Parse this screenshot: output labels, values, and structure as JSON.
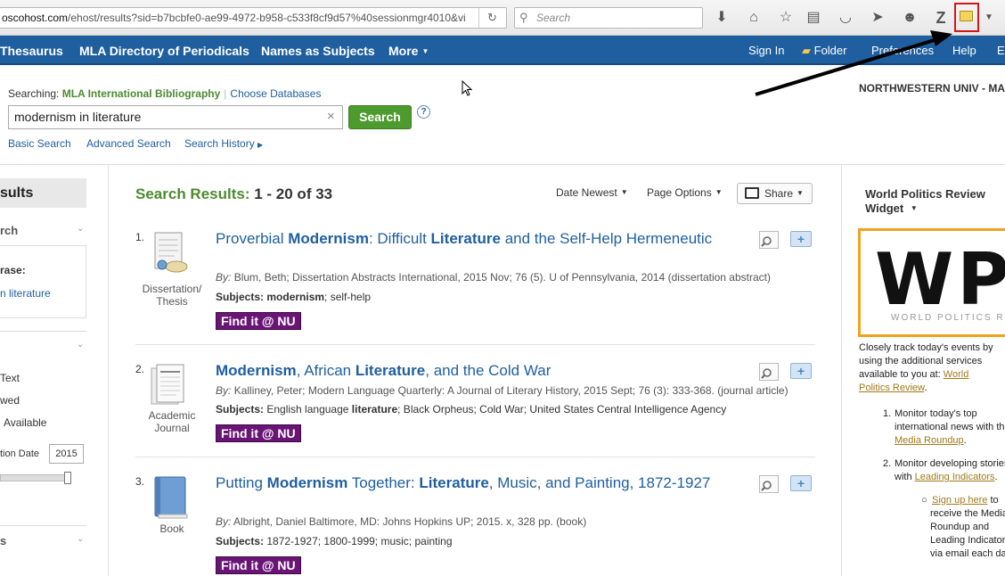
{
  "browser": {
    "url_host": "oscohost.com",
    "url_path": "/ehost/results?sid=b7bcbfe0-ae99-4972-b958-c533f8cf9d57%40sessionmgr4010&vi",
    "search_placeholder": "Search",
    "icons": [
      "download-icon",
      "home-icon",
      "bookmark-star-icon",
      "reading-list-icon",
      "pocket-icon",
      "send-icon",
      "chat-icon",
      "zotero-icon",
      "folder-icon",
      "menu-dropdown-icon"
    ],
    "highlight_color": "#d01818"
  },
  "nav": {
    "left": [
      "Thesaurus",
      "MLA Directory of Periodicals",
      "Names as Subjects",
      "More"
    ],
    "right": [
      "Sign In",
      "Folder",
      "Preferences",
      "Help",
      "E"
    ]
  },
  "search": {
    "searching_label": "Searching:",
    "database": "MLA International Bibliography",
    "choose_databases": "Choose Databases",
    "query": "modernism in literature",
    "button": "Search",
    "help": "?",
    "links": [
      "Basic Search",
      "Advanced Search",
      "Search History"
    ]
  },
  "institution": "NORTHWESTERN UNIV - MAIN",
  "sidebar": {
    "header": "sults",
    "section1": "rch",
    "phrase_label": "rase:",
    "phrase_value": "n literature",
    "limit1": "Text",
    "limit2": "wed",
    "limit3": "Available",
    "pubdate_label": "tion Date",
    "pubdate_to": "2015",
    "pubdate_fill": 0.9,
    "section3": "s"
  },
  "results": {
    "title_label": "Search Results:",
    "range": "1 - 20 of 33",
    "sort": "Date Newest",
    "page_options": "Page Options",
    "share": "Share",
    "find_label": "Find it @ NU",
    "items": [
      {
        "num": "1.",
        "type_line1": "Dissertation/",
        "type_line2": "Thesis",
        "title_parts": [
          [
            "Proverbial ",
            false
          ],
          [
            "Modernism",
            true
          ],
          [
            ": Difficult ",
            false
          ],
          [
            "Literature",
            true
          ],
          [
            " and the Self-Help Hermeneutic",
            false
          ]
        ],
        "by_label": "By:",
        "by": "Blum, Beth; Dissertation Abstracts International, 2015 Nov; 76 (5). U of Pennsylvania, 2014 (dissertation abstract)",
        "subjects_label": "Subjects:",
        "subjects_parts": [
          [
            "modernism",
            true
          ],
          [
            "; self-help",
            false
          ]
        ]
      },
      {
        "num": "2.",
        "type_line1": "Academic",
        "type_line2": "Journal",
        "title_parts": [
          [
            "Modernism",
            true
          ],
          [
            ", African ",
            false
          ],
          [
            "Literature",
            true
          ],
          [
            ", and the Cold War",
            false
          ]
        ],
        "by_label": "By:",
        "by": "Kalliney, Peter; Modern Language Quarterly: A Journal of Literary History, 2015 Sept; 76 (3): 333-368. (journal article)",
        "subjects_label": "Subjects:",
        "subjects_parts": [
          [
            "English language ",
            false
          ],
          [
            "literature",
            true
          ],
          [
            "; Black Orpheus; Cold War; United States Central Intelligence Agency",
            false
          ]
        ]
      },
      {
        "num": "3.",
        "type_line1": "Book",
        "type_line2": "",
        "title_parts": [
          [
            "Putting ",
            false
          ],
          [
            "Modernism",
            true
          ],
          [
            " Together: ",
            false
          ],
          [
            "Literature",
            true
          ],
          [
            ", Music, and Painting, 1872-1927",
            false
          ]
        ],
        "by_label": "By:",
        "by": "Albright, Daniel Baltimore, MD: Johns Hopkins UP; 2015. x, 328 pp. (book)",
        "subjects_label": "Subjects:",
        "subjects_parts": [
          [
            "1872-1927; 1800-1999; music; painting",
            false
          ]
        ]
      }
    ]
  },
  "widget": {
    "title": "World Politics Review Widget",
    "logo_letters": "WP",
    "logo_sub": "WORLD POLITICS R",
    "desc": "Closely track today's events by using the additional services available to you at:",
    "desc_link": "World Politics Review",
    "item1_num": "1.",
    "item1_a": "Monitor today's top",
    "item1_b": "international news with th",
    "item1_link": "Media Roundup",
    "item2_num": "2.",
    "item2_a": "Monitor developing stories",
    "item2_b": "with",
    "item2_link": "Leading Indicators",
    "sub_link": "Sign up here",
    "sub_a": "to",
    "sub_b": "receive the Media",
    "sub_c": "Roundup and",
    "sub_d": "Leading Indicators",
    "sub_e": "via email each day",
    "accent": "#f0a21c"
  }
}
